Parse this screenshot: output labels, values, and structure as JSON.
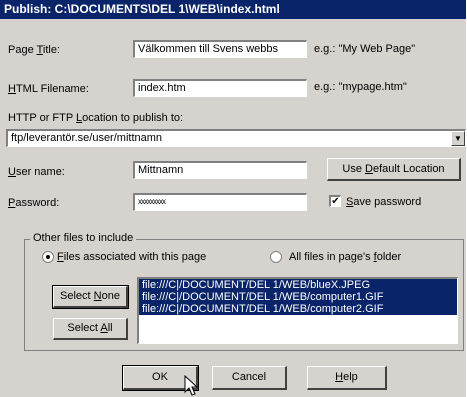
{
  "title": "Publish: C:\\DOCUMENTS\\DEL 1\\WEB\\index.html",
  "page_title": {
    "label_pre": "Page ",
    "label_u": "T",
    "label_post": "itle:",
    "value": "Välkommen till Svens webbs",
    "example": "e.g.: \"My Web Page\""
  },
  "html_filename": {
    "label_u": "H",
    "label_post": "TML Filename:",
    "value": "index.htm",
    "example": "e.g.: \"mypage.htm\""
  },
  "location": {
    "label_pre": "HTTP or FTP ",
    "label_u": "L",
    "label_post": "ocation to publish to:",
    "value": "ftp/leverantör.se/user/mittnamn"
  },
  "username": {
    "label_u": "U",
    "label_post": "ser name:",
    "value": "Mittnamn"
  },
  "password": {
    "label_u": "P",
    "label_post": "assword:",
    "value": "xxxxxxxxx"
  },
  "use_default_btn": {
    "pre": "Use ",
    "u": "D",
    "post": "efault Location"
  },
  "save_password": {
    "u": "S",
    "post": "ave password",
    "checked": true
  },
  "other_files": {
    "title": "Other files to include",
    "radio_assoc": {
      "u": "F",
      "post": "iles associated with this page",
      "selected": true
    },
    "radio_all": {
      "pre": "All files in page's ",
      "u": "f",
      "post": "older",
      "selected": false
    },
    "select_none": {
      "pre": "Select ",
      "u": "N",
      "post": "one"
    },
    "select_all": {
      "pre": "Select ",
      "u": "A",
      "post": "ll"
    },
    "files": [
      "file:///C|/DOCUMENT/DEL 1/WEB/blueX.JPEG",
      "file:///C|/DOCUMENT/DEL 1/WEB/computer1.GIF",
      "file:///C|/DOCUMENT/DEL 1/WEB/computer2.GIF"
    ]
  },
  "buttons": {
    "ok": "OK",
    "cancel": "Cancel",
    "help_u": "H",
    "help_post": "elp"
  },
  "colors": {
    "titlebar": "#0a246a",
    "face": "#d6d3ce",
    "selection": "#0a246a"
  }
}
